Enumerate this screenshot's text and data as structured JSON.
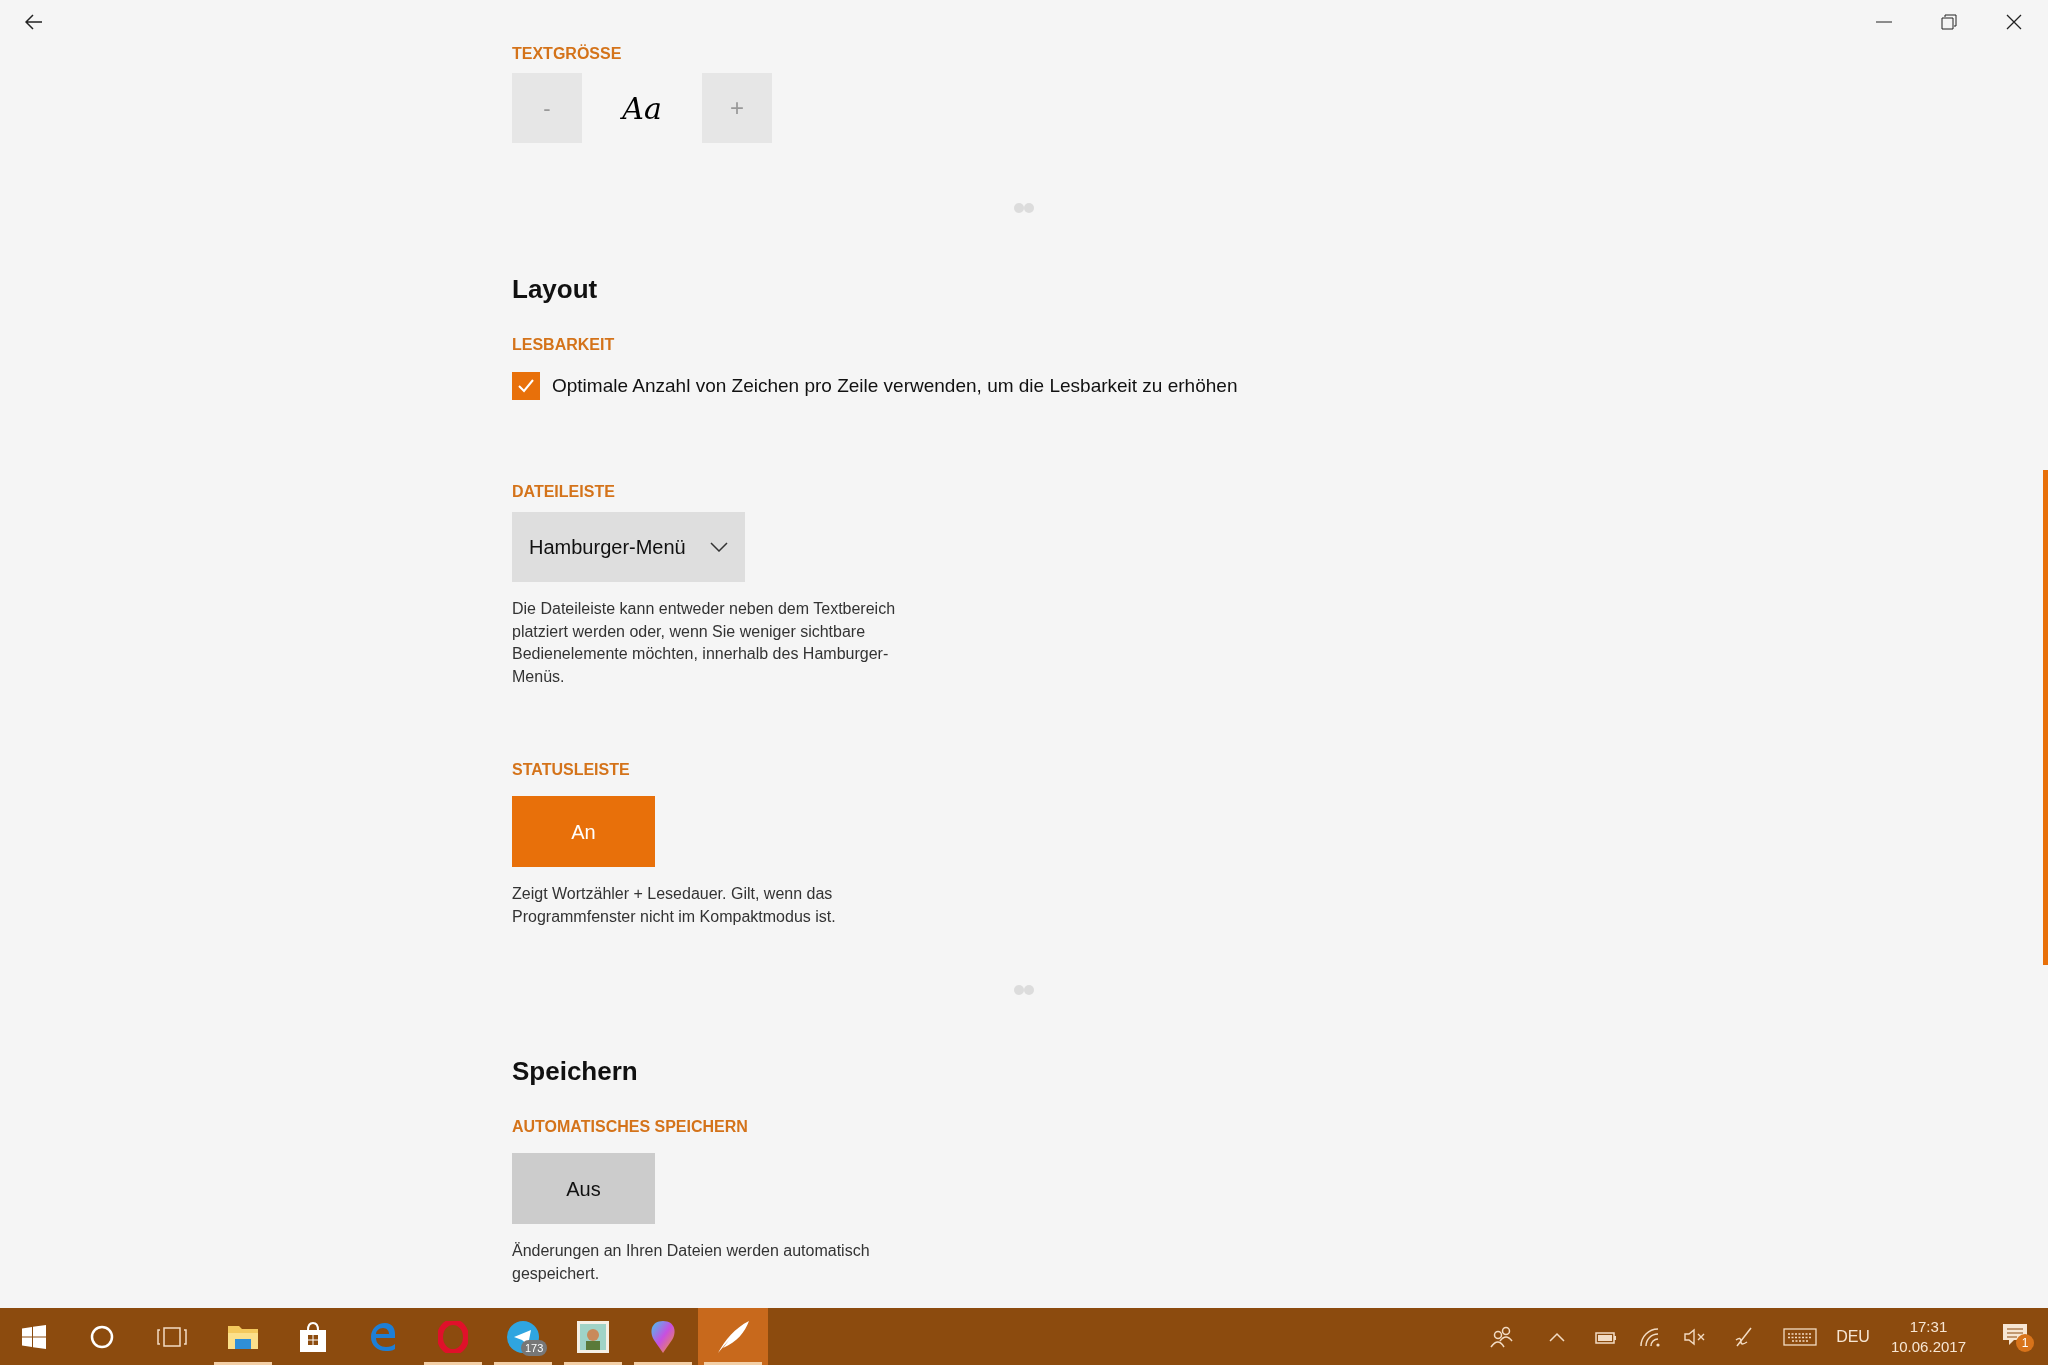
{
  "sections": [
    {
      "settings": [
        {
          "kind": "stepper",
          "label": "TEXTGRÖSSE",
          "minus": "-",
          "sample": "Aa",
          "plus": "+"
        }
      ]
    },
    {
      "heading": "Layout",
      "settings": [
        {
          "kind": "checkbox",
          "label": "LESBARKEIT",
          "checked": true,
          "text": "Optimale Anzahl von Zeichen pro Zeile verwenden, um die Lesbarkeit zu erhöhen"
        },
        {
          "kind": "dropdown",
          "label": "DATEILEISTE",
          "value": "Hamburger-Menü",
          "description": "Die Dateileiste kann entweder neben dem Textbereich platziert werden oder, wenn Sie weniger sichtbare Bedienelemente möchten, innerhalb des Hamburger-Menüs."
        },
        {
          "kind": "toggle",
          "label": "STATUSLEISTE",
          "on": true,
          "text": "An",
          "description": "Zeigt Wortzähler + Lesedauer. Gilt, wenn das Programmfenster nicht im Kompaktmodus ist."
        }
      ]
    },
    {
      "heading": "Speichern",
      "settings": [
        {
          "kind": "toggle",
          "label": "AUTOMATISCHES SPEICHERN",
          "on": false,
          "text": "Aus",
          "description": "Änderungen an Ihren Dateien werden automatisch gespeichert."
        }
      ]
    }
  ],
  "taskbar": {
    "apps": [
      {
        "kind": "explorer",
        "running": true,
        "selected": false
      },
      {
        "kind": "store",
        "running": false,
        "selected": false
      },
      {
        "kind": "edge",
        "running": false,
        "selected": false
      },
      {
        "kind": "opera",
        "running": true,
        "selected": false
      },
      {
        "kind": "telegram",
        "running": true,
        "selected": false,
        "badge": "173"
      },
      {
        "kind": "photo",
        "running": true,
        "selected": false
      },
      {
        "kind": "paint",
        "running": true,
        "selected": false
      },
      {
        "kind": "feather",
        "running": true,
        "selected": true
      }
    ],
    "language": "DEU",
    "time": "17:31",
    "date": "10.06.2017",
    "notifications": "1"
  }
}
